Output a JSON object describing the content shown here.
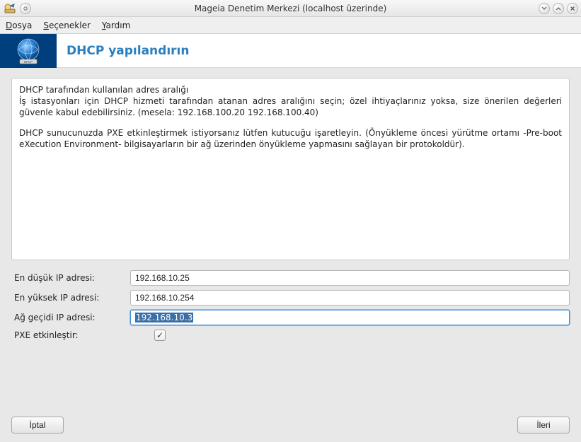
{
  "window": {
    "title": "Mageia Denetim Merkezi  (localhost üzerinde)"
  },
  "menubar": {
    "dosya": "Dosya",
    "secenekler": "Seçenekler",
    "yardim": "Yardım"
  },
  "banner": {
    "title": "DHCP yapılandırın",
    "logo_label": "DHCP"
  },
  "description": {
    "para1_line1": "DHCP tarafından kullanılan adres aralığı",
    "para1_line2": "İş istasyonları için DHCP hizmeti tarafından atanan adres aralığını seçin; özel ihtiyaçlarınız yoksa, size önerilen değerleri güvenle kabul edebilirsiniz. (mesela: 192.168.100.20 192.168.100.40)",
    "para2": "DHCP sunucunuzda PXE etkinleştirmek istiyorsanız lütfen kutucuğu işaretleyin. (Önyükleme öncesi yürütme ortamı -Pre-boot eXecution Environment- bilgisayarların bir ağ üzerinden önyükleme yapmasını sağlayan bir protokoldür)."
  },
  "form": {
    "lowest_label": "En düşük IP adresi:",
    "lowest_value": "192.168.10.25",
    "highest_label": "En yüksek IP adresi:",
    "highest_value": "192.168.10.254",
    "gateway_label": "Ağ geçidi IP adresi:",
    "gateway_value": "192.168.10.3",
    "pxe_label": "PXE etkinleştir:",
    "pxe_checked": "✓"
  },
  "buttons": {
    "cancel": "İptal",
    "next": "İleri"
  }
}
